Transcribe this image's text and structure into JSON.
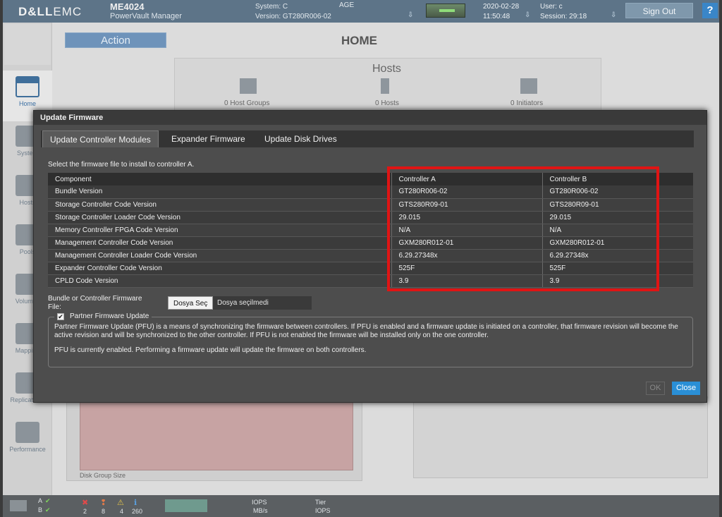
{
  "header": {
    "logo_bold": "D&LL",
    "logo_rest": "EMC",
    "model": "ME4024",
    "product": "PowerVault Manager",
    "system_label": "System: C",
    "system_name": "AGE",
    "version_label": "Version: GT280R006-02",
    "date": "2020-02-28",
    "time": "11:50:48",
    "user": "User: c",
    "session": "Session: 29:18",
    "signout": "Sign Out",
    "help": "?"
  },
  "background": {
    "action": "Action",
    "page_title": "HOME",
    "hosts_title": "Hosts",
    "host_groups": "0 Host Groups",
    "hosts": "0 Hosts",
    "initiators": "0 Initiators",
    "disk_group_size": "Disk Group Size",
    "nav": [
      "Home",
      "System",
      "Hosts",
      "Pools",
      "Volumes",
      "Mapping",
      "Replications",
      "Performance"
    ]
  },
  "statusbar": {
    "ctrl_a": "A",
    "ctrl_b": "B",
    "counts": [
      "2",
      "8",
      "4",
      "260"
    ],
    "iops": "IOPS",
    "mbs": "MB/s",
    "tier": "Tier",
    "tier_iops": "IOPS"
  },
  "modal": {
    "title": "Update Firmware",
    "tabs": [
      "Update Controller Modules",
      "Expander Firmware",
      "Update Disk Drives"
    ],
    "instruction": "Select the firmware file to install to controller A.",
    "table": {
      "headers": [
        "Component",
        "Controller A",
        "Controller B"
      ],
      "rows": [
        [
          "Bundle Version",
          "GT280R006-02",
          "GT280R006-02"
        ],
        [
          "Storage Controller Code Version",
          "GTS280R09-01",
          "GTS280R09-01"
        ],
        [
          "Storage Controller Loader Code Version",
          "29.015",
          "29.015"
        ],
        [
          "Memory Controller FPGA Code Version",
          "N/A",
          "N/A"
        ],
        [
          "Management Controller Code Version",
          "GXM280R012-01",
          "GXM280R012-01"
        ],
        [
          "Management Controller Loader Code Version",
          "6.29.27348x",
          "6.29.27348x"
        ],
        [
          "Expander Controller Code Version",
          "525F",
          "525F"
        ],
        [
          "CPLD Code Version",
          "3.9",
          "3.9"
        ]
      ]
    },
    "file_label": "Bundle or Controller Firmware File:",
    "file_button": "Dosya Seç",
    "file_status": "Dosya seçilmedi",
    "pfu_legend": "Partner Firmware Update",
    "pfu_checked": true,
    "pfu_description": "Partner Firmware Update (PFU) is a means of synchronizing the firmware between controllers. If PFU is enabled and a firmware update is initiated on a controller, that firmware revision will become the active revision and will be synchronized to the other controller. If PFU is not enabled the firmware will be installed only on the one controller.",
    "pfu_status": "PFU is currently enabled. Performing a firmware update will update the firmware on both controllers.",
    "ok": "OK",
    "close": "Close"
  },
  "colors": {
    "highlight": "#e01414",
    "close_button": "#2a8fd6",
    "header": "#5d7488"
  }
}
